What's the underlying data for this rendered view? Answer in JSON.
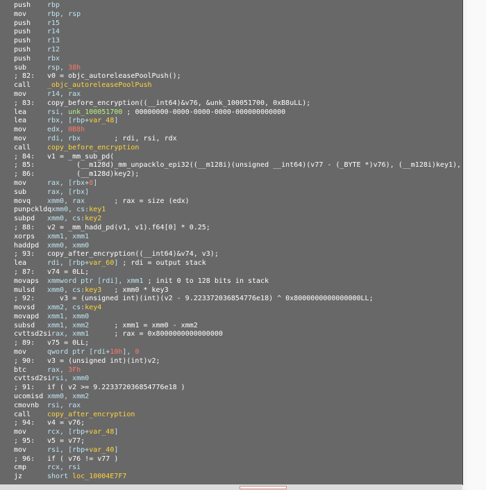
{
  "lines": [
    {
      "m": "push",
      "parts": [
        {
          "c": "op",
          "t": "rbp"
        }
      ]
    },
    {
      "m": "mov",
      "parts": [
        {
          "c": "op",
          "t": "rbp, rsp"
        }
      ]
    },
    {
      "m": "push",
      "parts": [
        {
          "c": "op",
          "t": "r15"
        }
      ]
    },
    {
      "m": "push",
      "parts": [
        {
          "c": "op",
          "t": "r14"
        }
      ]
    },
    {
      "m": "push",
      "parts": [
        {
          "c": "op",
          "t": "r13"
        }
      ]
    },
    {
      "m": "push",
      "parts": [
        {
          "c": "op",
          "t": "r12"
        }
      ]
    },
    {
      "m": "push",
      "parts": [
        {
          "c": "op",
          "t": "rbx"
        }
      ]
    },
    {
      "m": "sub",
      "parts": [
        {
          "c": "op",
          "t": "rsp, "
        },
        {
          "c": "num",
          "t": "38h"
        }
      ]
    },
    {
      "m": "; 82:",
      "parts": [
        {
          "c": "cmt",
          "t": "v0 = objc_autoreleasePoolPush();"
        }
      ]
    },
    {
      "m": "call",
      "parts": [
        {
          "c": "sym",
          "t": "_objc_autoreleasePoolPush"
        }
      ]
    },
    {
      "m": "mov",
      "parts": [
        {
          "c": "op",
          "t": "r14, rax"
        }
      ]
    },
    {
      "m": "; 83:",
      "parts": [
        {
          "c": "cmt",
          "t": "copy_before_encryption((__int64)&v76, &unk_100051700, 0xB8uLL);"
        }
      ]
    },
    {
      "m": "lea",
      "parts": [
        {
          "c": "op",
          "t": "rsi, "
        },
        {
          "c": "gsym",
          "t": "unk_100051700"
        },
        {
          "c": "cmt",
          "t": " ; 00000000-0000-0000-0000-000000000000"
        }
      ]
    },
    {
      "m": "lea",
      "parts": [
        {
          "c": "op",
          "t": "rbx, [rbp+"
        },
        {
          "c": "sym",
          "t": "var_48"
        },
        {
          "c": "op",
          "t": "]"
        }
      ]
    },
    {
      "m": "mov",
      "parts": [
        {
          "c": "op",
          "t": "edx, "
        },
        {
          "c": "num",
          "t": "0B8h"
        }
      ]
    },
    {
      "m": "mov",
      "parts": [
        {
          "c": "op",
          "t": "rdi, rbx"
        },
        {
          "c": "cmt",
          "t": "        ; rdi, rsi, rdx"
        }
      ]
    },
    {
      "m": "call",
      "parts": [
        {
          "c": "sym",
          "t": "copy_before_encryption"
        }
      ]
    },
    {
      "m": "; 84:",
      "parts": [
        {
          "c": "cmt",
          "t": "v1 = _mm_sub_pd("
        }
      ]
    },
    {
      "m": "; 85:",
      "parts": [
        {
          "c": "cmt",
          "t": "       (__m128d)_mm_unpacklo_epi32((__m128i)(unsigned __int64)(v77 - (_BYTE *)v76), (__m128i)key1),"
        }
      ]
    },
    {
      "m": "; 86:",
      "parts": [
        {
          "c": "cmt",
          "t": "       (__m128d)key2);"
        }
      ]
    },
    {
      "m": "mov",
      "parts": [
        {
          "c": "op",
          "t": "rax, [rbx+"
        },
        {
          "c": "num",
          "t": "8"
        },
        {
          "c": "op",
          "t": "]"
        }
      ]
    },
    {
      "m": "sub",
      "parts": [
        {
          "c": "op",
          "t": "rax, [rbx]"
        }
      ]
    },
    {
      "m": "movq",
      "parts": [
        {
          "c": "op",
          "t": "xmm0, rax"
        },
        {
          "c": "cmt",
          "t": "       ; rax = size (edx)"
        }
      ]
    },
    {
      "m": "punpckldq",
      "parts": [
        {
          "c": "op",
          "t": " xmm0, cs:"
        },
        {
          "c": "sym",
          "t": "key1"
        }
      ]
    },
    {
      "m": "subpd",
      "parts": [
        {
          "c": "op",
          "t": "xmm0, cs:"
        },
        {
          "c": "sym",
          "t": "key2"
        }
      ]
    },
    {
      "m": "; 88:",
      "parts": [
        {
          "c": "cmt",
          "t": "v2 = _mm_hadd_pd(v1, v1).f64[0] * 0.25;"
        }
      ]
    },
    {
      "m": "xorps",
      "parts": [
        {
          "c": "op",
          "t": "xmm1, xmm1"
        }
      ]
    },
    {
      "m": "haddpd",
      "parts": [
        {
          "c": "op",
          "t": "xmm0, xmm0"
        }
      ]
    },
    {
      "m": "; 93:",
      "parts": [
        {
          "c": "cmt",
          "t": "copy_after_encryption((__int64)&v74, v3);"
        }
      ]
    },
    {
      "m": "lea",
      "parts": [
        {
          "c": "op",
          "t": "rdi, [rbp+"
        },
        {
          "c": "sym",
          "t": "var_60"
        },
        {
          "c": "op",
          "t": "]"
        },
        {
          "c": "cmt",
          "t": " ; rdi = output stack"
        }
      ]
    },
    {
      "m": "; 87:",
      "parts": [
        {
          "c": "cmt",
          "t": "v74 = 0LL;"
        }
      ]
    },
    {
      "m": "movaps",
      "parts": [
        {
          "c": "op",
          "t": "xmmword ptr [rdi], xmm1"
        },
        {
          "c": "cmt",
          "t": " ; init 0 to 128 bits in stack"
        }
      ]
    },
    {
      "m": "mulsd",
      "parts": [
        {
          "c": "op",
          "t": "xmm0, cs:"
        },
        {
          "c": "sym",
          "t": "key3"
        },
        {
          "c": "cmt",
          "t": "   ; xmm0 * key3"
        }
      ]
    },
    {
      "m": "; 92:",
      "parts": [
        {
          "c": "cmt",
          "t": "   v3 = (unsigned int)(int)(v2 - 9.223372036854776e18) ^ 0x8000000000000000LL;"
        }
      ]
    },
    {
      "m": "movsd",
      "parts": [
        {
          "c": "op",
          "t": "xmm2, cs:"
        },
        {
          "c": "sym",
          "t": "key4"
        }
      ]
    },
    {
      "m": "movapd",
      "parts": [
        {
          "c": "op",
          "t": "xmm1, xmm0"
        }
      ]
    },
    {
      "m": "subsd",
      "parts": [
        {
          "c": "op",
          "t": "xmm1, xmm2"
        },
        {
          "c": "cmt",
          "t": "      ; xmm1 = xmm0 - xmm2"
        }
      ]
    },
    {
      "m": "cvttsd2si",
      "parts": [
        {
          "c": "op",
          "t": " rax, xmm1"
        },
        {
          "c": "cmt",
          "t": "      ; rax = 0x8000000000000000"
        }
      ]
    },
    {
      "m": "; 89:",
      "parts": [
        {
          "c": "cmt",
          "t": "v75 = 0LL;"
        }
      ]
    },
    {
      "m": "mov",
      "parts": [
        {
          "c": "op",
          "t": "qword ptr [rdi+"
        },
        {
          "c": "num",
          "t": "10h"
        },
        {
          "c": "op",
          "t": "], "
        },
        {
          "c": "num",
          "t": "0"
        }
      ]
    },
    {
      "m": "; 90:",
      "parts": [
        {
          "c": "cmt",
          "t": "v3 = (unsigned int)(int)v2;"
        }
      ]
    },
    {
      "m": "btc",
      "parts": [
        {
          "c": "op",
          "t": "rax, "
        },
        {
          "c": "num",
          "t": "3Fh"
        }
      ]
    },
    {
      "m": "cvttsd2si",
      "parts": [
        {
          "c": "op",
          "t": " rsi, xmm0"
        }
      ]
    },
    {
      "m": "; 91:",
      "parts": [
        {
          "c": "cmt",
          "t": "if ( v2 >= 9.223372036854776e18 )"
        }
      ]
    },
    {
      "m": "ucomisd",
      "parts": [
        {
          "c": "op",
          "t": "xmm0, xmm2"
        }
      ]
    },
    {
      "m": "cmovnb",
      "parts": [
        {
          "c": "op",
          "t": "rsi, rax"
        }
      ]
    },
    {
      "m": "call",
      "parts": [
        {
          "c": "sym",
          "t": "copy_after_encryption"
        }
      ]
    },
    {
      "m": "; 94:",
      "parts": [
        {
          "c": "cmt",
          "t": "v4 = v76;"
        }
      ]
    },
    {
      "m": "mov",
      "parts": [
        {
          "c": "op",
          "t": "rcx, [rbp+"
        },
        {
          "c": "sym",
          "t": "var_48"
        },
        {
          "c": "op",
          "t": "]"
        }
      ]
    },
    {
      "m": "; 95:",
      "parts": [
        {
          "c": "cmt",
          "t": "v5 = v77;"
        }
      ]
    },
    {
      "m": "mov",
      "parts": [
        {
          "c": "op",
          "t": "rsi, [rbp+"
        },
        {
          "c": "sym",
          "t": "var_40"
        },
        {
          "c": "op",
          "t": "]"
        }
      ]
    },
    {
      "m": "; 96:",
      "parts": [
        {
          "c": "cmt",
          "t": "if ( v76 != v77 )"
        }
      ]
    },
    {
      "m": "cmp",
      "parts": [
        {
          "c": "op",
          "t": "rcx, rsi"
        }
      ]
    },
    {
      "m": "jz",
      "parts": [
        {
          "c": "op",
          "t": "short "
        },
        {
          "c": "sym",
          "t": "loc_10004E7F7"
        }
      ]
    }
  ]
}
